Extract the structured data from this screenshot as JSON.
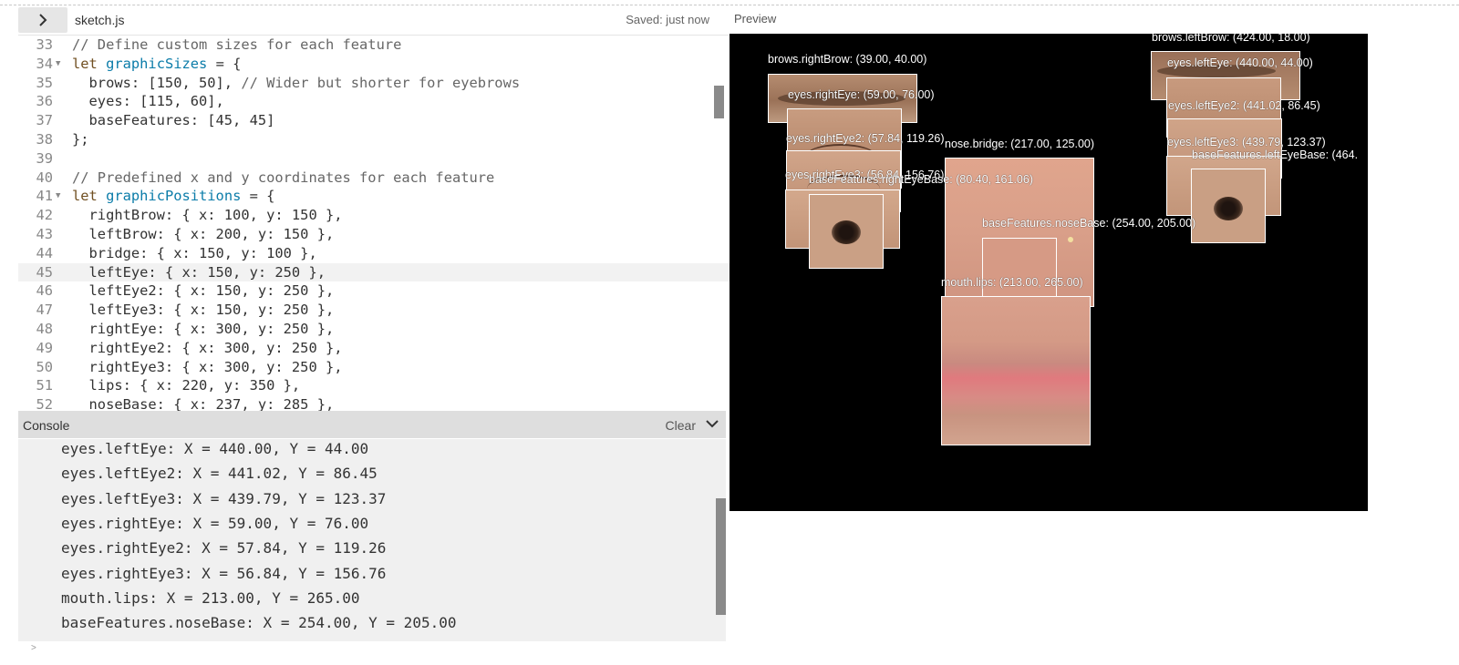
{
  "editor": {
    "toggle_icon": "chevron-right-icon",
    "file_name": "sketch.js",
    "saved_status": "Saved: just now"
  },
  "code_lines": [
    {
      "n": "33",
      "t": "// Define custom sizes for each feature"
    },
    {
      "n": "34",
      "t": "let graphicSizes = {"
    },
    {
      "n": "35",
      "t": "  brows: [150, 50], // Wider but shorter for eyebrows"
    },
    {
      "n": "36",
      "t": "  eyes: [115, 60],"
    },
    {
      "n": "37",
      "t": "  baseFeatures: [45, 45]"
    },
    {
      "n": "38",
      "t": "};"
    },
    {
      "n": "39",
      "t": ""
    },
    {
      "n": "40",
      "t": "// Predefined x and y coordinates for each feature"
    },
    {
      "n": "41",
      "t": "let graphicPositions = {"
    },
    {
      "n": "42",
      "t": "  rightBrow: { x: 100, y: 150 },"
    },
    {
      "n": "43",
      "t": "  leftBrow: { x: 200, y: 150 },"
    },
    {
      "n": "44",
      "t": "  bridge: { x: 150, y: 100 },"
    },
    {
      "n": "45",
      "t": "  leftEye: { x: 150, y: 250 },"
    },
    {
      "n": "46",
      "t": "  leftEye2: { x: 150, y: 250 },"
    },
    {
      "n": "47",
      "t": "  leftEye3: { x: 150, y: 250 },"
    },
    {
      "n": "48",
      "t": "  rightEye: { x: 300, y: 250 },"
    },
    {
      "n": "49",
      "t": "  rightEye2: { x: 300, y: 250 },"
    },
    {
      "n": "50",
      "t": "  rightEye3: { x: 300, y: 250 },"
    },
    {
      "n": "51",
      "t": "  lips: { x: 220, y: 350 },"
    },
    {
      "n": "52",
      "t": "  noseBase: { x: 237, y: 285 },"
    }
  ],
  "console": {
    "title": "Console",
    "clear_label": "Clear",
    "collapse_icon": "chevron-down-icon",
    "lines": [
      "eyes.leftEye: X = 440.00, Y = 44.00",
      "eyes.leftEye2: X = 441.02, Y = 86.45",
      "eyes.leftEye3: X = 439.79, Y = 123.37",
      "eyes.rightEye: X = 59.00, Y = 76.00",
      "eyes.rightEye2: X = 57.84, Y = 119.26",
      "eyes.rightEye3: X = 56.84, Y = 156.76",
      "mouth.lips: X = 213.00, Y = 265.00",
      "baseFeatures.noseBase: X = 254.00, Y = 205.00"
    ],
    "prompt_symbol": ">"
  },
  "preview": {
    "label": "Preview",
    "canvas_labels": {
      "right_brow": "brows.rightBrow: (39.00, 40.00)",
      "left_brow": "brows.leftBrow: (424.00, 18.00)",
      "right_eye": "eyes.rightEye: (59.00, 76.00)",
      "left_eye": "eyes.leftEye: (440.00, 44.00)",
      "right_eye2": "eyes.rightEye2: (57.84, 119.26)",
      "left_eye2": "eyes.leftEye2: (441.02, 86.45)",
      "right_eye3": "eyes.rightEye3: (56.84, 156.76)",
      "left_eye3": "eyes.leftEye3: (439.79, 123.37)",
      "right_eye_base": "baseFeatures.rightEyeBase: (80.40, 161.06)",
      "left_eye_base": "baseFeatures.leftEyeBase: (464.",
      "nose_bridge": "nose.bridge: (217.00, 125.00)",
      "nose_base": "baseFeatures.noseBase: (254.00, 205.00)",
      "lips": "mouth.lips: (213.00, 265.00)"
    }
  }
}
